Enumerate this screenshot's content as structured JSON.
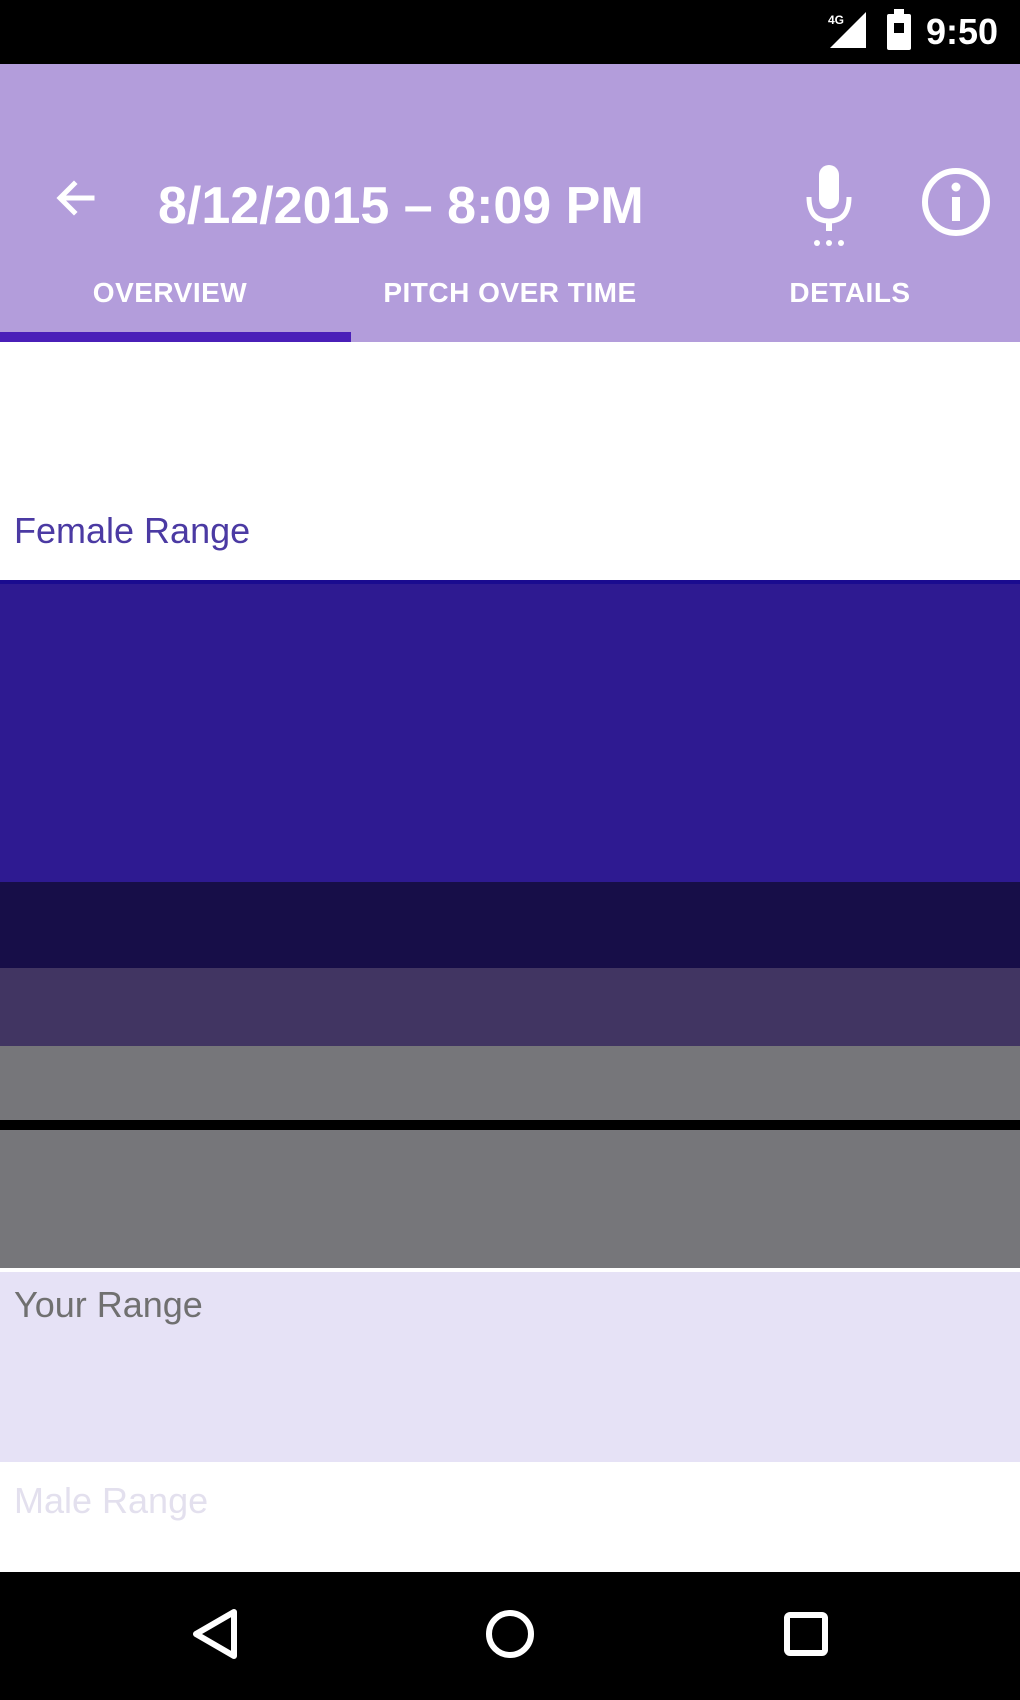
{
  "status_bar": {
    "time": "9:50",
    "signal_badge": "4G",
    "icons": [
      "signal-icon",
      "battery-icon"
    ]
  },
  "app_bar": {
    "title": "8/12/2015 – 8:09 PM",
    "icons": [
      "back-arrow-icon",
      "microphone-icon",
      "info-icon"
    ],
    "color": "#b39ddb"
  },
  "tabs": [
    {
      "label": "OVERVIEW",
      "selected": true
    },
    {
      "label": "PITCH OVER TIME",
      "selected": false
    },
    {
      "label": "DETAILS",
      "selected": false
    }
  ],
  "overview": {
    "female_range_label": "Female Range",
    "your_range_label": "Your Range",
    "male_range_label": "Male Range",
    "colors": {
      "female_band": "#2e1a91",
      "dark_band": "#170e48",
      "mid_band": "#413562",
      "grey_band": "#76767a",
      "your_range_band": "#e6e2f6"
    }
  },
  "nav_bar": {
    "icons": [
      "nav-back-icon",
      "nav-home-icon",
      "nav-recents-icon"
    ]
  }
}
